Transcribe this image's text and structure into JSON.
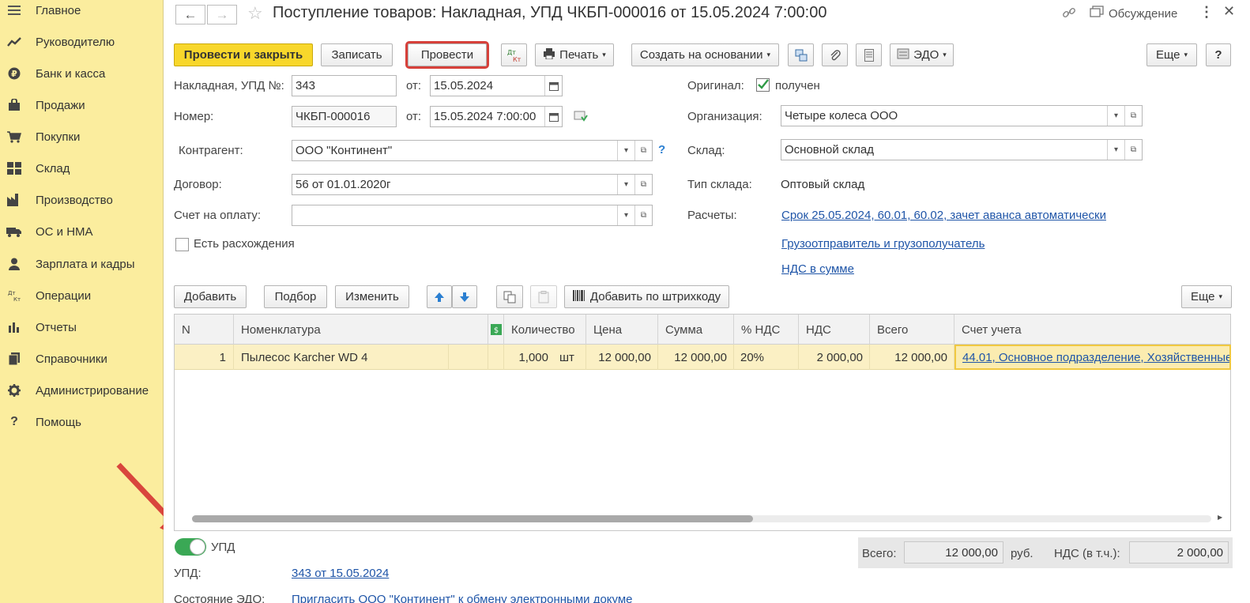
{
  "sidebar": {
    "items": [
      {
        "label": "Главное",
        "icon": "menu-icon"
      },
      {
        "label": "Руководителю",
        "icon": "trend-icon"
      },
      {
        "label": "Банк и касса",
        "icon": "ruble-icon"
      },
      {
        "label": "Продажи",
        "icon": "bag-icon"
      },
      {
        "label": "Покупки",
        "icon": "cart-icon"
      },
      {
        "label": "Склад",
        "icon": "warehouse-icon"
      },
      {
        "label": "Производство",
        "icon": "factory-icon"
      },
      {
        "label": "ОС и НМА",
        "icon": "truck-icon"
      },
      {
        "label": "Зарплата и кадры",
        "icon": "person-icon"
      },
      {
        "label": "Операции",
        "icon": "dt-kt-icon"
      },
      {
        "label": "Отчеты",
        "icon": "bar-chart-icon"
      },
      {
        "label": "Справочники",
        "icon": "book-icon"
      },
      {
        "label": "Администрирование",
        "icon": "gear-icon"
      },
      {
        "label": "Помощь",
        "icon": "help-icon"
      }
    ]
  },
  "header": {
    "title": "Поступление товаров: Накладная, УПД ЧКБП-000016 от 15.05.2024 7:00:00",
    "discussion": "Обсуждение"
  },
  "toolbar": {
    "post_close": "Провести и закрыть",
    "save": "Записать",
    "post": "Провести",
    "dt_kt": "Дт\nКт",
    "print": "Печать",
    "create_based": "Создать на основании",
    "edo": "ЭДО",
    "more": "Еще",
    "help": "?"
  },
  "form": {
    "invoice_label": "Накладная, УПД №:",
    "invoice_number": "343",
    "from_label": "от:",
    "invoice_date": "15.05.2024",
    "number_label": "Номер:",
    "number": "ЧКБП-000016",
    "number_date": "15.05.2024  7:00:00",
    "counterparty_label": "Контрагент:",
    "counterparty": "ООО \"Континент\"",
    "contract_label": "Договор:",
    "contract": "56 от 01.01.2020г",
    "payment_label": "Счет на оплату:",
    "payment": "",
    "discrepancy_label": "Есть расхождения",
    "original_label": "Оригинал:",
    "original_value": "получен",
    "org_label": "Организация:",
    "org": "Четыре колеса ООО",
    "warehouse_label": "Склад:",
    "warehouse": "Основной склад",
    "wh_type_label": "Тип склада:",
    "wh_type": "Оптовый склад",
    "settlements_label": "Расчеты:",
    "settlements_link": "Срок 25.05.2024, 60.01, 60.02, зачет аванса автоматически",
    "shipper_link": "Грузоотправитель и грузополучатель",
    "vat_link": "НДС в сумме"
  },
  "table_toolbar": {
    "add": "Добавить",
    "pick": "Подбор",
    "edit": "Изменить",
    "barcode": "Добавить по штрихкоду",
    "more": "Еще"
  },
  "table": {
    "headers": {
      "n": "N",
      "item": "Номенклатура",
      "qty": "Количество",
      "price": "Цена",
      "sum": "Сумма",
      "vat_rate": "% НДС",
      "vat": "НДС",
      "total": "Всего",
      "account": "Счет учета"
    },
    "rows": [
      {
        "n": "1",
        "item": "Пылесос Karcher WD 4",
        "qty": "1,000",
        "unit": "шт",
        "price": "12 000,00",
        "sum": "12 000,00",
        "vat_rate": "20%",
        "vat": "2 000,00",
        "total": "12 000,00",
        "account": "44.01, Основное подразделение, Хозяйственные"
      }
    ]
  },
  "footer": {
    "upd_toggle_label": "УПД",
    "upd_label": "УПД:",
    "upd_link": "343 от 15.05.2024",
    "edo_state_label": "Состояние ЭДО:",
    "edo_state_link": "Пригласить ООО \"Континент\" к обмену электронными докуме",
    "total_label": "Всего:",
    "total_value": "12 000,00",
    "currency": "руб.",
    "vat_label": "НДС (в т.ч.):",
    "vat_value": "2 000,00"
  },
  "colors": {
    "sidebar_bg": "#fbed9e",
    "primary_button": "#f8d72b",
    "highlight_outline": "#d6403a",
    "link": "#1f55a8",
    "selected_row": "#fbf0c4",
    "toggle_on": "#3aa855",
    "annotation_arrow": "#d9463d"
  }
}
